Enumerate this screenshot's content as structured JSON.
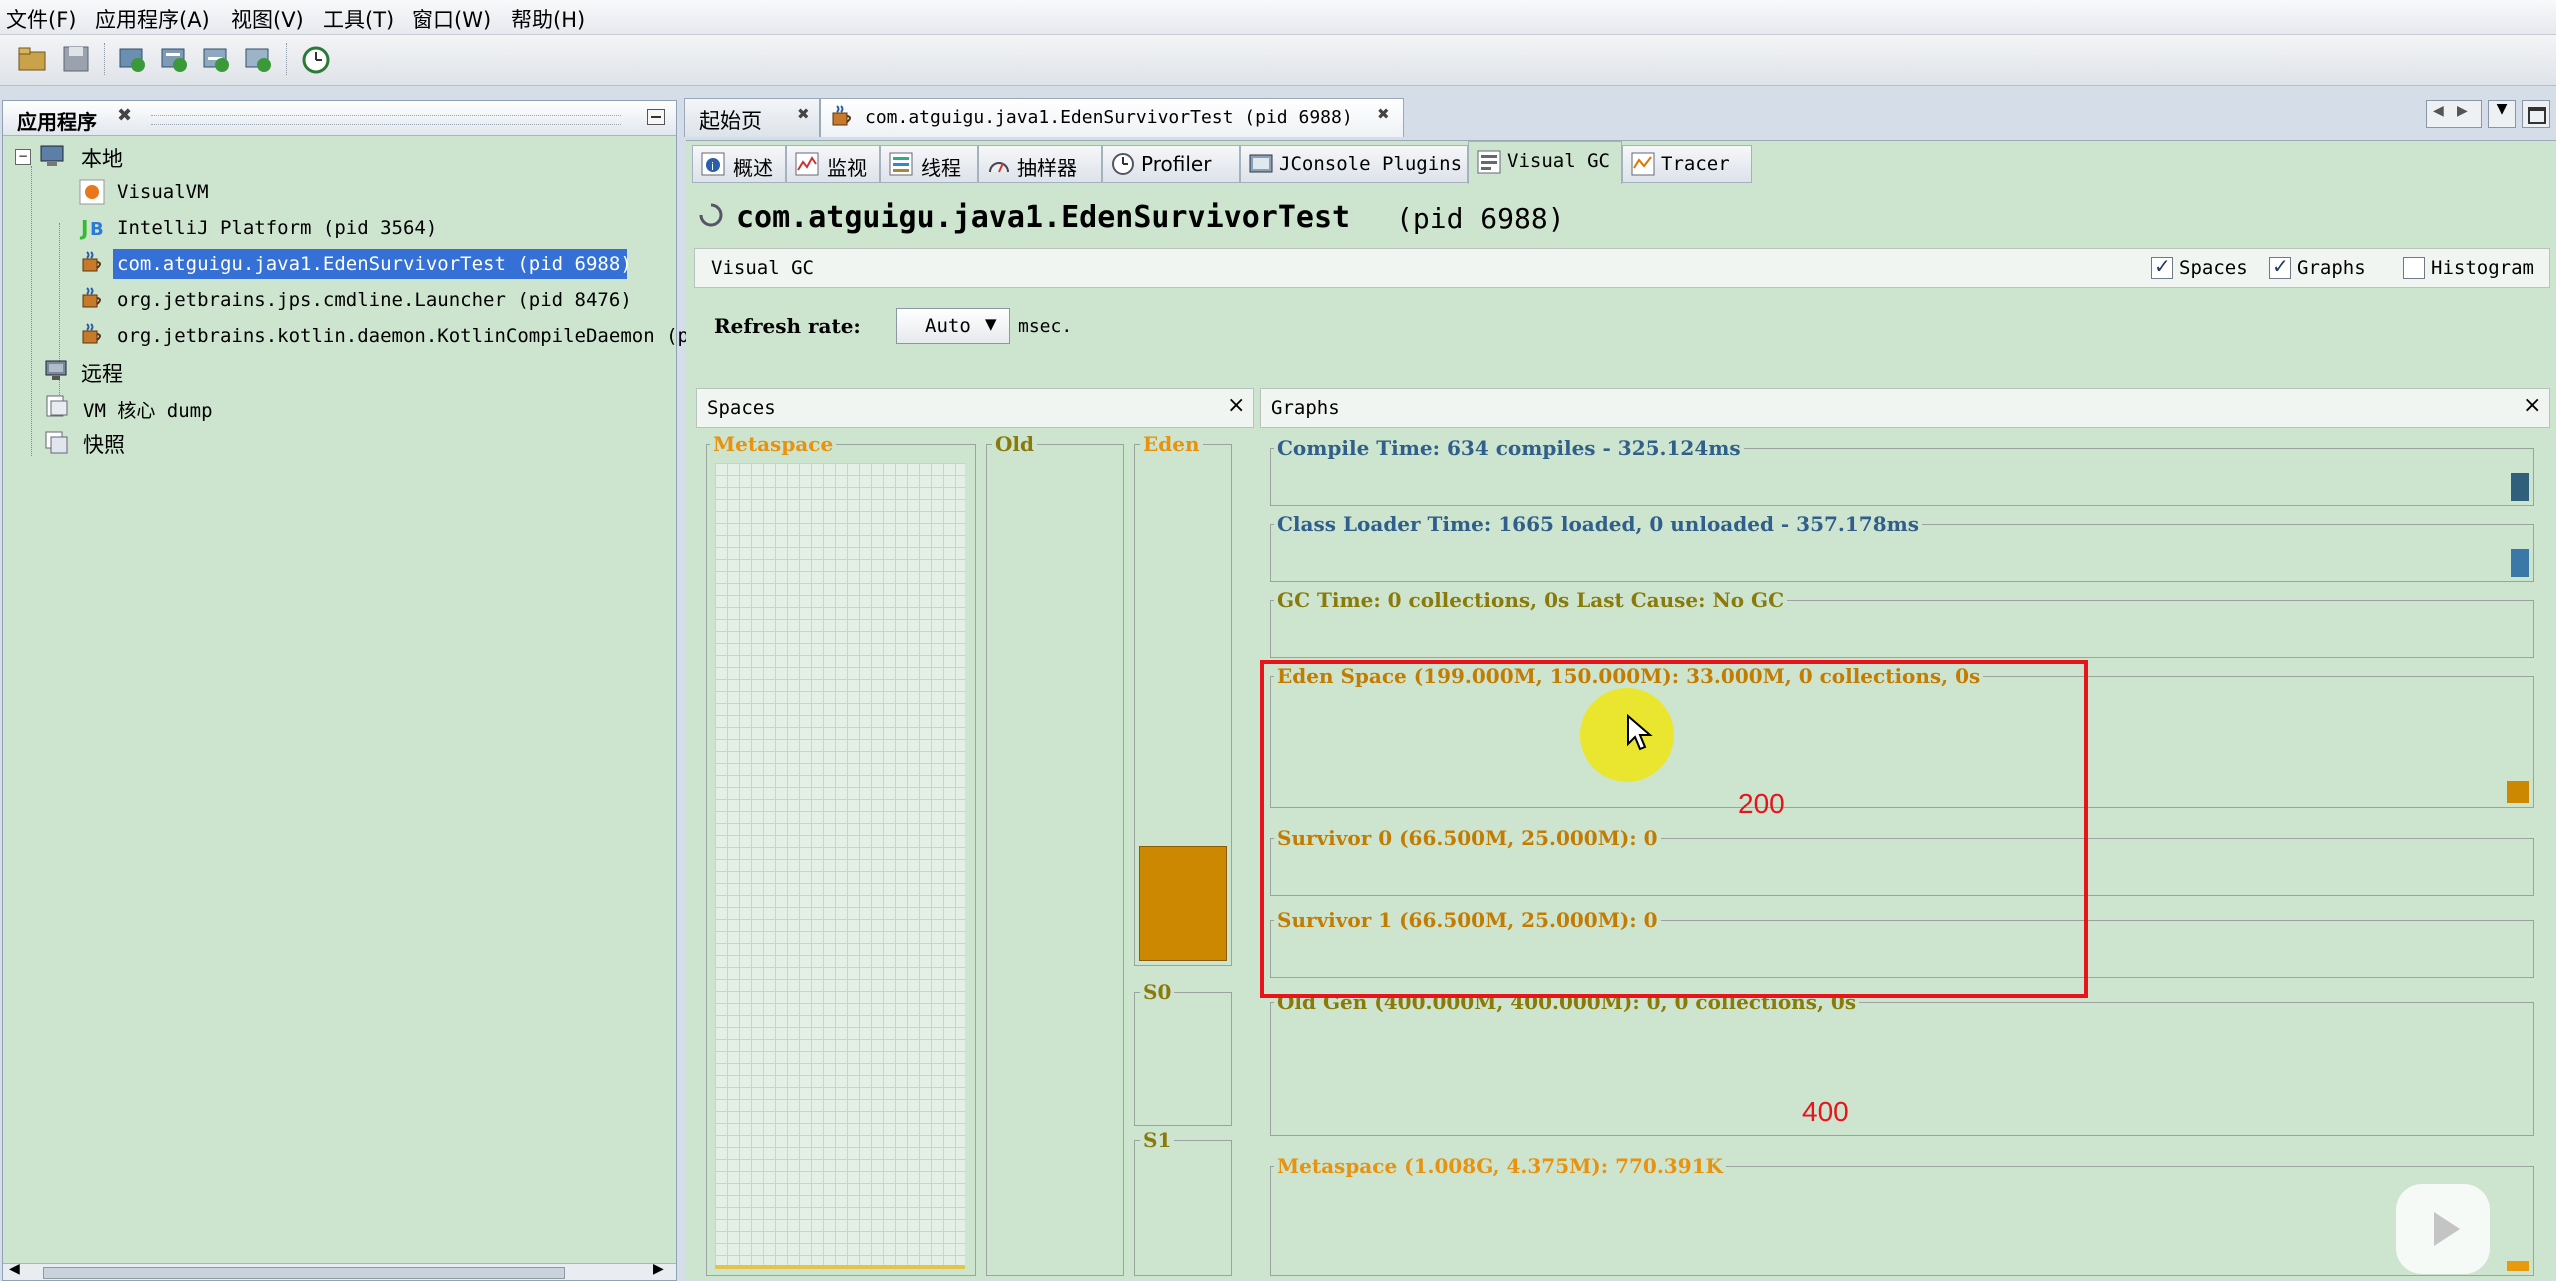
{
  "menu": [
    "文件(F)",
    "应用程序(A)",
    "视图(V)",
    "工具(T)",
    "窗口(W)",
    "帮助(H)"
  ],
  "toolbar": {
    "icons": [
      "open-file-icon",
      "save-icon",
      "add-jmx-icon",
      "add-coredump-icon",
      "add-heapdump-icon",
      "add-snapshot-icon",
      "profiler-icon"
    ]
  },
  "left_panel": {
    "title": "应用程序",
    "tree": {
      "local": "本地",
      "local_items": [
        "VisualVM",
        "IntelliJ Platform (pid 3564)",
        "com.atguigu.java1.EdenSurvivorTest (pid 6988)",
        "org.jetbrains.jps.cmdline.Launcher (pid 8476)",
        "org.jetbrains.kotlin.daemon.KotlinCompileDaemon (p"
      ],
      "remote": "远程",
      "coredump": "VM 核心 dump",
      "snapshots": "快照"
    }
  },
  "doc_tabs": [
    "起始页",
    "com.atguigu.java1.EdenSurvivorTest (pid 6988)"
  ],
  "sub_tabs": [
    "概述",
    "监视",
    "线程",
    "抽样器",
    "Profiler",
    "JConsole Plugins",
    "Visual GC",
    "Tracer"
  ],
  "main": {
    "title_name": "com.atguigu.java1.EdenSurvivorTest",
    "title_pid": "(pid 6988)",
    "section_label": "Visual GC",
    "options": {
      "spaces": "Spaces",
      "graphs": "Graphs",
      "histogram": "Histogram",
      "spaces_checked": true,
      "graphs_checked": true,
      "histogram_checked": false
    },
    "refresh_label": "Refresh rate:",
    "refresh_value": "Auto",
    "refresh_unit": "msec."
  },
  "spaces_panel": {
    "title": "Spaces",
    "metaspace": "Metaspace",
    "old": "Old",
    "eden": "Eden",
    "s0": "S0",
    "s1": "S1",
    "eden_fill_fraction": 0.22
  },
  "graphs_panel": {
    "title": "Graphs",
    "rows": [
      "Compile Time: 634 compiles - 325.124ms",
      "Class Loader Time: 1665 loaded, 0 unloaded - 357.178ms",
      "GC Time: 0 collections, 0s Last Cause: No GC",
      "Eden Space (199.000M, 150.000M): 33.000M, 0 collections, 0s",
      "Survivor 0 (66.500M, 25.000M): 0",
      "Survivor 1 (66.500M, 25.000M): 0",
      "Old Gen (400.000M, 400.000M): 0, 0 collections, 0s",
      "Metaspace (1.008G, 4.375M): 770.391K"
    ]
  },
  "annotations": {
    "a1": "200",
    "a2": "400"
  },
  "colors": {
    "accent_blue": "#2f5f8a",
    "eden_orange": "#cc8800",
    "annotation_red": "#e8141b",
    "panel_green": "#cde4cf"
  }
}
